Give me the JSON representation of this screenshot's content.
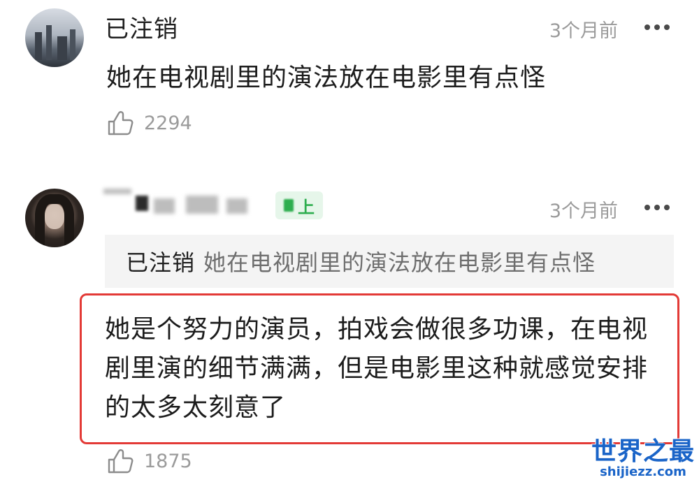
{
  "comments": [
    {
      "username": "已注销",
      "time": "3个月前",
      "text": "她在电视剧里的演法放在电影里有点怪",
      "likes": "2294"
    },
    {
      "username_blurred": true,
      "badge": "上",
      "time": "3个月前",
      "quote": {
        "username": "已注销",
        "text": "她在电视剧里的演法放在电影里有点怪"
      },
      "text": "她是个努力的演员，拍戏会做很多功课，在电视剧里演的细节满满，但是电影里这种就感觉安排的太多太刻意了",
      "likes": "1875"
    }
  ],
  "watermark": {
    "title": "世界之最",
    "url": "shijiezz.com"
  },
  "colors": {
    "highlight_border": "#e33a36",
    "badge_text": "#2eae4f",
    "badge_bg": "#e6f6ea",
    "watermark": "#1a64c8"
  },
  "icons": [
    "thumbs-up-icon",
    "more-dots-icon"
  ]
}
